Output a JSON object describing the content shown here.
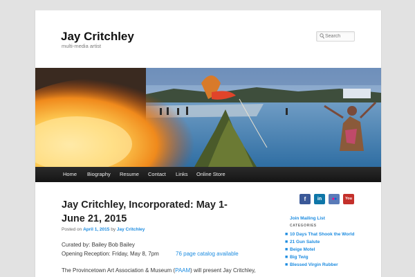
{
  "site": {
    "title": "Jay Critchley",
    "description": "multi-media artist"
  },
  "search": {
    "placeholder": "Search",
    "icon": "search-icon"
  },
  "nav": {
    "items": [
      {
        "label": "Home"
      },
      {
        "label": "Biography"
      },
      {
        "label": "Resume"
      },
      {
        "label": "Contact"
      },
      {
        "label": "Links"
      },
      {
        "label": "Online Store"
      }
    ]
  },
  "post": {
    "title": "Jay Critchley, Incorporated: May 1-June 21, 2015",
    "meta": {
      "posted_on": "Posted on",
      "date": "April 1, 2015",
      "by": "by",
      "author": "Jay Critchley"
    },
    "curated": "Curated by: Bailey Bob Bailey",
    "reception": "Opening Reception: Friday, May 8, 7pm",
    "catalog_link": "76 page catalog available",
    "intro_start": "The Provincetown Art Association & Museum (",
    "intro_link": "PAAM",
    "intro_end": ") will present Jay Critchley,"
  },
  "sidebar": {
    "social": [
      {
        "name": "facebook",
        "glyph": "f",
        "color": "#3b5998"
      },
      {
        "name": "linkedin",
        "glyph": "in",
        "color": "#0e76a8"
      },
      {
        "name": "flickr",
        "glyph": "••",
        "color": "#5a7bb8"
      },
      {
        "name": "youtube",
        "glyph": "You",
        "color": "#c4302b"
      }
    ],
    "mailing_list": "Join Mailing List",
    "categories_heading": "CATEGORIES",
    "categories": [
      "10 Days That Shook the World",
      "21 Gun Salute",
      "Beige Motel",
      "Big Twig",
      "Blessed Virgin Rubber"
    ]
  },
  "colors": {
    "link": "#1b8be0",
    "nav_bg": "#1f1f1f",
    "page_bg": "#e2e2e2"
  }
}
